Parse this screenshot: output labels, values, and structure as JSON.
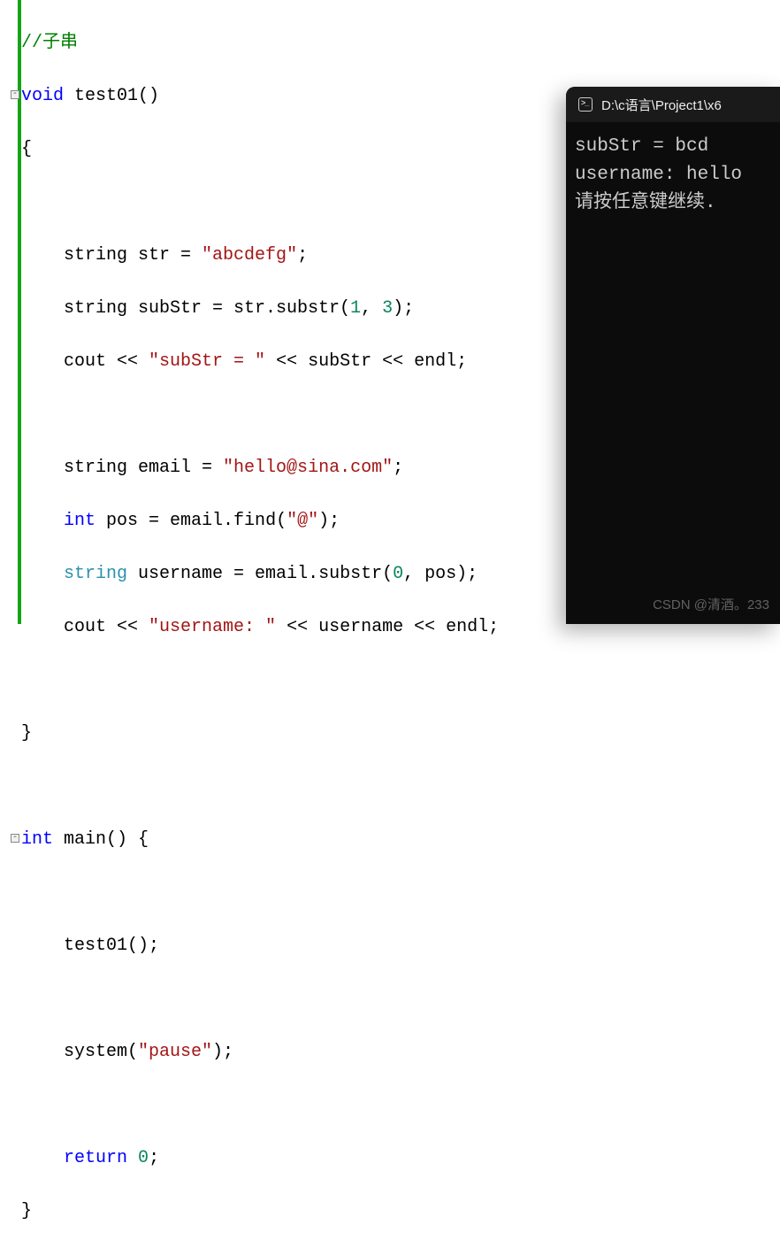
{
  "code": {
    "comment": "//子串",
    "l2_p1": "void",
    "l2_p2": " test01()",
    "l3": "{",
    "l5_p1": "    string str = ",
    "l5_s": "\"abcdefg\"",
    "l5_p2": ";",
    "l6_p1": "    string subStr = str.substr(",
    "l6_n1": "1",
    "l6_c": ", ",
    "l6_n2": "3",
    "l6_p2": ");",
    "l7_p1": "    cout << ",
    "l7_s": "\"subStr = \"",
    "l7_p2": " << subStr << endl;",
    "l9_p1": "    string email = ",
    "l9_s": "\"hello@sina.com\"",
    "l9_p2": ";",
    "l10_p1": "    ",
    "l10_kw": "int",
    "l10_p2": " pos = email.find(",
    "l10_s": "\"@\"",
    "l10_p3": ");",
    "l11_p1": "    ",
    "l11_t": "string",
    "l11_p2": " username = email.substr(",
    "l11_n1": "0",
    "l11_c": ", pos);",
    "l12_p1": "    cout << ",
    "l12_s": "\"username: \"",
    "l12_p2": " << username << endl;",
    "l14": "}",
    "l16_p1": "int",
    "l16_p2": " main() {",
    "l18": "    test01();",
    "l20_p1": "    system(",
    "l20_s": "\"pause\"",
    "l20_p2": ");",
    "l22_p1": "    ",
    "l22_kw": "return",
    "l22_sp": " ",
    "l22_n": "0",
    "l22_p2": ";",
    "l23": "}"
  },
  "console": {
    "title": "D:\\c语言\\Project1\\x6",
    "output_l1": "subStr = bcd",
    "output_l2": "username: hello",
    "output_l3": "请按任意键继续."
  },
  "watermark": "CSDN @清酒。233"
}
